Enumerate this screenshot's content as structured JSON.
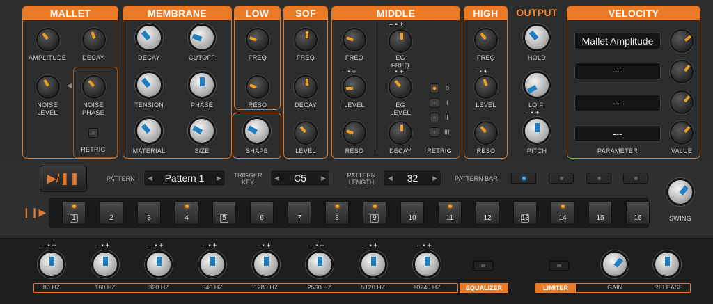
{
  "sections": {
    "mallet": {
      "title": "MALLET",
      "amplitude": "AMPLITUDE",
      "decay": "DECAY",
      "noise_level": "NOISE\nLEVEL",
      "noise_phase": "NOISE\nPHASE",
      "retrig": "RETRIG"
    },
    "membrane": {
      "title": "MEMBRANE",
      "decay": "DECAY",
      "cutoff": "CUTOFF",
      "tension": "TENSION",
      "phase": "PHASE",
      "material": "MATERIAL",
      "size": "SIZE",
      "shape": "SHAPE"
    },
    "low": {
      "title": "LOW",
      "freq": "FREQ",
      "reso": "RESO"
    },
    "sof": {
      "title": "SOF",
      "freq": "FREQ",
      "decay": "DECAY",
      "level": "LEVEL"
    },
    "middle": {
      "title": "MIDDLE",
      "freq": "FREQ",
      "eg_freq": "EG\nFREQ",
      "level": "LEVEL",
      "eg_level": "EG\nLEVEL",
      "reso": "RESO",
      "decay": "DECAY",
      "retrig": "RETRIG",
      "opts": [
        "0",
        "I",
        "II",
        "III"
      ]
    },
    "high": {
      "title": "HIGH",
      "freq": "FREQ",
      "level": "LEVEL",
      "reso": "RESO"
    },
    "output": {
      "title": "OUTPUT",
      "hold": "HOLD",
      "lofi": "LO FI",
      "pitch": "PITCH"
    },
    "velocity": {
      "title": "VELOCITY",
      "param1": "Mallet Amplitude",
      "param2": "---",
      "param3": "---",
      "param4": "---",
      "parameter": "PARAMETER",
      "value": "VALUE"
    }
  },
  "sequencer": {
    "pattern_label": "PATTERN",
    "pattern_value": "Pattern 1",
    "trigger_label": "TRIGGER\nKEY",
    "trigger_value": "C5",
    "length_label": "PATTERN\nLENGTH",
    "length_value": "32",
    "patternbar_label": "PATTERN BAR",
    "swing": "SWING",
    "steps": [
      "1",
      "2",
      "3",
      "4",
      "5",
      "6",
      "7",
      "8",
      "9",
      "10",
      "11",
      "12",
      "13",
      "14",
      "15",
      "16"
    ],
    "on": [
      1,
      0,
      0,
      1,
      0,
      0,
      0,
      1,
      1,
      0,
      1,
      0,
      0,
      1,
      0,
      0
    ],
    "boxed": [
      1,
      0,
      0,
      0,
      1,
      0,
      0,
      0,
      1,
      0,
      0,
      0,
      1,
      0,
      0,
      0
    ]
  },
  "eq": {
    "bands": [
      "80 HZ",
      "160 HZ",
      "320 HZ",
      "640 HZ",
      "1280 HZ",
      "2560 HZ",
      "5120 HZ",
      "10240 HZ"
    ],
    "equalizer": "EQUALIZER",
    "limiter": "LIMITER",
    "gain": "GAIN",
    "release": "RELEASE"
  },
  "colors": {
    "accent": "#ea7a25",
    "led": "#ffa020",
    "blue": "#3fb0ff"
  }
}
